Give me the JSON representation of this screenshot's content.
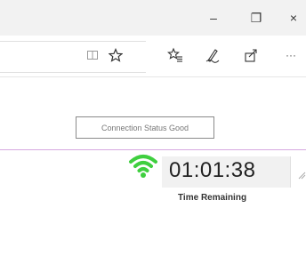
{
  "window": {
    "controls": {
      "minimize": "–",
      "maximize": "❐",
      "close": "×"
    }
  },
  "toolbar": {
    "icons": [
      "reading-view-icon",
      "favorite-star-icon",
      "favorites-hub-icon",
      "pen-icon",
      "share-icon",
      "more-icon"
    ],
    "more_label": "···"
  },
  "status": {
    "text": "Connection Status Good"
  },
  "timer": {
    "value": "01:01:38",
    "label": "Time Remaining"
  },
  "colors": {
    "wifi": "#3fcf3f",
    "divider": "#d6a8e0"
  }
}
